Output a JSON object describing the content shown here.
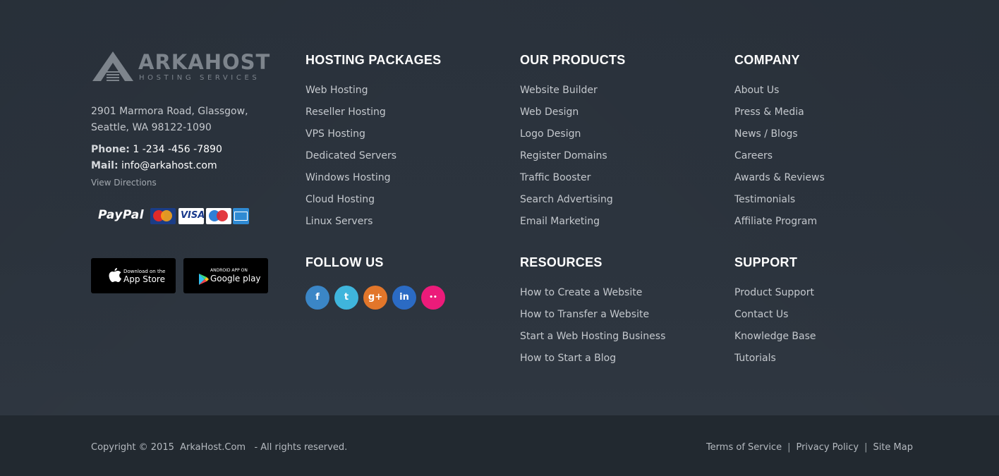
{
  "brand": {
    "name": "ARKAHOST",
    "tagline": "HOSTING SERVICES"
  },
  "address": {
    "line1": "2901 Marmora Road, Glassgow,",
    "line2": "Seattle, WA 98122-1090"
  },
  "contact": {
    "phone_label": "Phone:",
    "phone": "1 -234 -456 -7890",
    "mail_label": "Mail:",
    "mail": "info@arkahost.com",
    "directions": "View Directions"
  },
  "payments": {
    "paypal": "PayPal",
    "visa": "VISA",
    "cards": [
      "mastercard",
      "visa",
      "maestro",
      "american-express"
    ]
  },
  "apps": {
    "appstore_small": "Download on the",
    "appstore_big": "App Store",
    "google_small": "ANDROID APP ON",
    "google_big": "Google play"
  },
  "columns": {
    "hosting": {
      "title": "HOSTING PACKAGES",
      "items": [
        "Web Hosting",
        "Reseller Hosting",
        "VPS Hosting",
        "Dedicated Servers",
        "Windows Hosting",
        "Cloud Hosting",
        "Linux Servers"
      ]
    },
    "products": {
      "title": "OUR PRODUCTS",
      "items": [
        "Website Builder",
        "Web Design",
        "Logo Design",
        "Register Domains",
        "Traffic Booster",
        "Search Advertising",
        "Email Marketing"
      ]
    },
    "company": {
      "title": "COMPANY",
      "items": [
        "About Us",
        "Press & Media",
        "News / Blogs",
        "Careers",
        "Awards & Reviews",
        "Testimonials",
        "Affiliate Program"
      ]
    },
    "follow": {
      "title": "FOLLOW US"
    },
    "resources": {
      "title": "RESOURCES",
      "items": [
        "How to Create a Website",
        "How to Transfer a Website",
        "Start a Web Hosting Business",
        "How to Start a Blog"
      ]
    },
    "support": {
      "title": "SUPPORT",
      "items": [
        "Product Support",
        "Contact Us",
        "Knowledge Base",
        "Tutorials"
      ]
    }
  },
  "social": [
    {
      "icon": "facebook-icon",
      "glyph": "f",
      "color": "#3b86c6"
    },
    {
      "icon": "twitter-icon",
      "glyph": "t",
      "color": "#3fb5dc"
    },
    {
      "icon": "google-plus-icon",
      "glyph": "g+",
      "color": "#e2762a"
    },
    {
      "icon": "linkedin-icon",
      "glyph": "in",
      "color": "#2b6bc4"
    },
    {
      "icon": "flickr-icon",
      "glyph": "••",
      "color": "#ec1b7a"
    }
  ],
  "bottom": {
    "copyright": "Copyright © 2015  ArkaHost.Com   - All rights reserved.",
    "terms": "Terms of Service",
    "separator": "|",
    "privacy": "Privacy Policy",
    "sitemap": "Site Map"
  }
}
